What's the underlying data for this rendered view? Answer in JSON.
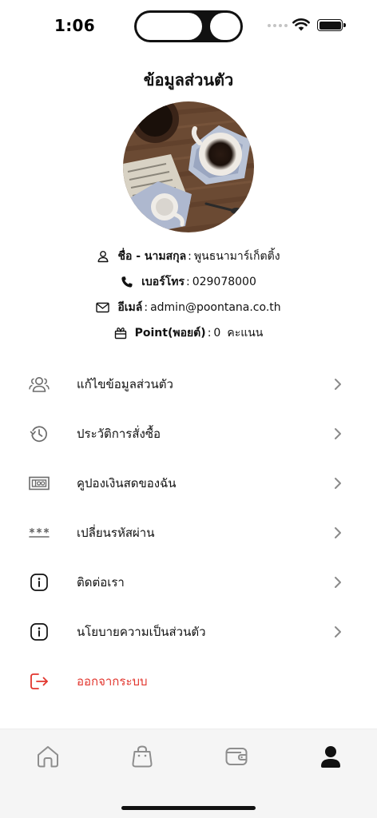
{
  "status_bar": {
    "time": "1:06"
  },
  "header": {
    "title": "ข้อมูลส่วนตัว"
  },
  "profile": {
    "avatar_icon": "coffee-photo",
    "name_label": "ชื่อ - นามสกุล",
    "name_value": "พูนธนามาร์เก็ตติ้ง",
    "phone_label": "เบอร์โทร",
    "phone_value": "029078000",
    "email_label": "อีเมล์",
    "email_value": "admin@poontana.co.th",
    "point_label": "Point(พอยต์)",
    "point_value": "0",
    "point_unit": "คะแนน"
  },
  "menu": [
    {
      "label": "แก้ไขข้อมูลส่วนตัว",
      "icon": "users-icon"
    },
    {
      "label": "ประวัติการสั่งซื้อ",
      "icon": "history-icon"
    },
    {
      "label": "คูปองเงินสดของฉัน",
      "icon": "coupon-icon"
    },
    {
      "label": "เปลี่ยนรหัสผ่าน",
      "icon": "password-icon"
    },
    {
      "label": "ติดต่อเรา",
      "icon": "info-icon"
    },
    {
      "label": "นโยบายความเป็นส่วนตัว",
      "icon": "info-icon"
    },
    {
      "label": "ออกจากระบบ",
      "icon": "logout-icon"
    }
  ],
  "tabs": [
    {
      "name": "home",
      "icon": "home-icon"
    },
    {
      "name": "shop",
      "icon": "shopping-bag-icon"
    },
    {
      "name": "wallet",
      "icon": "wallet-icon"
    },
    {
      "name": "profile",
      "icon": "user-icon",
      "active": true
    }
  ],
  "colors": {
    "accent_logout": "#e2362e",
    "icon_gray": "#6b6b6b",
    "tab_bar_bg": "#f5f5f5"
  }
}
